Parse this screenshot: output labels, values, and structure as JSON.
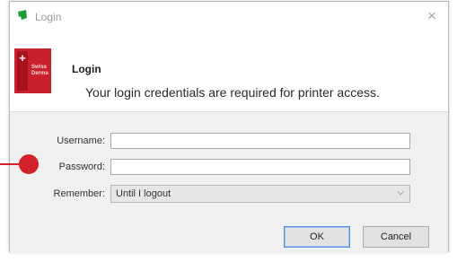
{
  "window": {
    "title": "Login",
    "close_glyph": "×"
  },
  "header": {
    "title": "Login",
    "description": "Your login credentials are required for printer access.",
    "logo_text": "Swiss\nDerma"
  },
  "form": {
    "username_label": "Username:",
    "username_value": "",
    "password_label": "Password:",
    "password_value": "",
    "remember_label": "Remember:",
    "remember_value": "Until I logout"
  },
  "buttons": {
    "ok_label": "OK",
    "cancel_label": "Cancel"
  },
  "icons": {
    "app": "app-icon",
    "close": "close-icon",
    "dropdown": "chevron-down-icon"
  },
  "colors": {
    "accent": "#4f8fd8",
    "logo": "#c8202c",
    "callout": "#d1222b"
  }
}
